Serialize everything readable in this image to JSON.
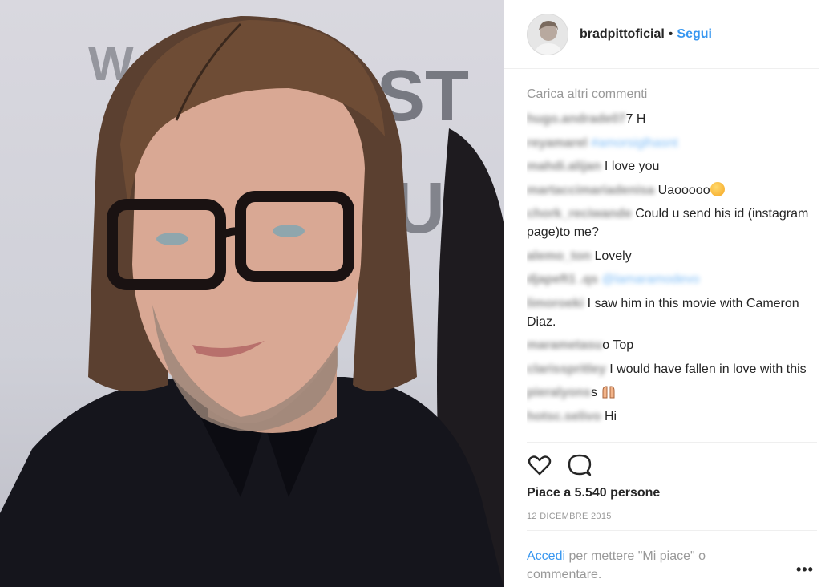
{
  "post": {
    "photo_icon": "portrait-photo",
    "username": "bradpittoficial",
    "separator": "•",
    "follow_label": "Segui"
  },
  "comments": {
    "load_more": "Carica altri commenti",
    "items": [
      {
        "user": "hugo.andrade07",
        "text": "7 H",
        "mention": ""
      },
      {
        "user": "reyamarel",
        "text": "",
        "mention": "#amorsiglhasnt"
      },
      {
        "user": "mahdi.alijan",
        "text": "I love you",
        "mention": ""
      },
      {
        "user": "martaccimariadenisa",
        "text": "Uaooooo",
        "mention": "",
        "emoji": "face-emoji"
      },
      {
        "user": "chork_reciwande",
        "text": "Could u send his id (instagram page)to me?",
        "mention": ""
      },
      {
        "user": "alemo_ton",
        "text": "Lovely",
        "mention": ""
      },
      {
        "user": "djapeft1 .qs",
        "text": "",
        "mention": "@lamaramodevo"
      },
      {
        "user": "limoroeki",
        "text": "I saw him in this movie with Cameron Diaz.",
        "mention": ""
      },
      {
        "user": "marametasu",
        "text": "o Top",
        "mention": ""
      },
      {
        "user": "clarisspritley",
        "text": "I would have fallen in love with this",
        "mention": ""
      },
      {
        "user": "pieralyons",
        "text": "s",
        "mention": "",
        "emoji": "raised-hands-emoji"
      },
      {
        "user": "hotsc.selivo",
        "text": "Hi",
        "mention": ""
      }
    ]
  },
  "actions": {
    "like_icon": "heart-icon",
    "comment_icon": "comment-bubble-icon"
  },
  "likes_text": "Piace a 5.540 persone",
  "date_text": "12 DICEMBRE 2015",
  "login": {
    "link": "Accedi",
    "rest": " per mettere \"Mi piace\" o commentare."
  },
  "more_label": "•••",
  "colors": {
    "accent": "#3897f0",
    "muted": "#999999",
    "text": "#262626"
  }
}
